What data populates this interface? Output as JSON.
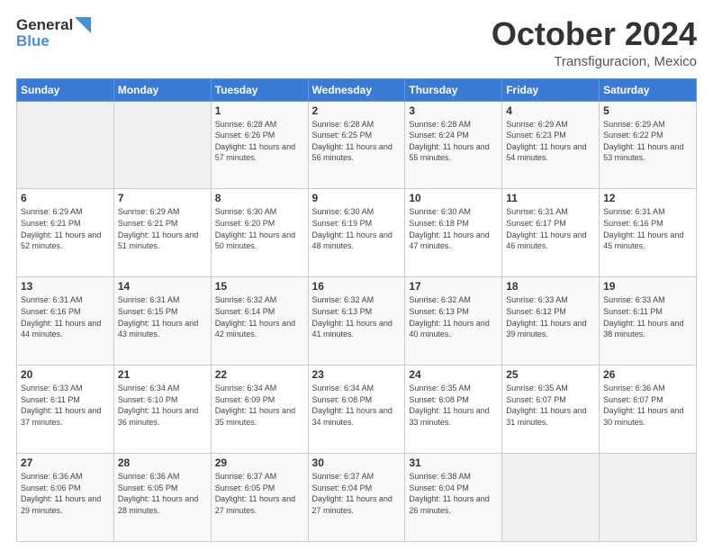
{
  "logo": {
    "line1": "General",
    "line2": "Blue"
  },
  "title": "October 2024",
  "location": "Transfiguracion, Mexico",
  "header_days": [
    "Sunday",
    "Monday",
    "Tuesday",
    "Wednesday",
    "Thursday",
    "Friday",
    "Saturday"
  ],
  "weeks": [
    [
      null,
      null,
      {
        "day": 1,
        "sunrise": "6:28 AM",
        "sunset": "6:26 PM",
        "daylight": "11 hours and 57 minutes."
      },
      {
        "day": 2,
        "sunrise": "6:28 AM",
        "sunset": "6:25 PM",
        "daylight": "11 hours and 56 minutes."
      },
      {
        "day": 3,
        "sunrise": "6:28 AM",
        "sunset": "6:24 PM",
        "daylight": "11 hours and 55 minutes."
      },
      {
        "day": 4,
        "sunrise": "6:29 AM",
        "sunset": "6:23 PM",
        "daylight": "11 hours and 54 minutes."
      },
      {
        "day": 5,
        "sunrise": "6:29 AM",
        "sunset": "6:22 PM",
        "daylight": "11 hours and 53 minutes."
      }
    ],
    [
      {
        "day": 6,
        "sunrise": "6:29 AM",
        "sunset": "6:21 PM",
        "daylight": "11 hours and 52 minutes."
      },
      {
        "day": 7,
        "sunrise": "6:29 AM",
        "sunset": "6:21 PM",
        "daylight": "11 hours and 51 minutes."
      },
      {
        "day": 8,
        "sunrise": "6:30 AM",
        "sunset": "6:20 PM",
        "daylight": "11 hours and 50 minutes."
      },
      {
        "day": 9,
        "sunrise": "6:30 AM",
        "sunset": "6:19 PM",
        "daylight": "11 hours and 48 minutes."
      },
      {
        "day": 10,
        "sunrise": "6:30 AM",
        "sunset": "6:18 PM",
        "daylight": "11 hours and 47 minutes."
      },
      {
        "day": 11,
        "sunrise": "6:31 AM",
        "sunset": "6:17 PM",
        "daylight": "11 hours and 46 minutes."
      },
      {
        "day": 12,
        "sunrise": "6:31 AM",
        "sunset": "6:16 PM",
        "daylight": "11 hours and 45 minutes."
      }
    ],
    [
      {
        "day": 13,
        "sunrise": "6:31 AM",
        "sunset": "6:16 PM",
        "daylight": "11 hours and 44 minutes."
      },
      {
        "day": 14,
        "sunrise": "6:31 AM",
        "sunset": "6:15 PM",
        "daylight": "11 hours and 43 minutes."
      },
      {
        "day": 15,
        "sunrise": "6:32 AM",
        "sunset": "6:14 PM",
        "daylight": "11 hours and 42 minutes."
      },
      {
        "day": 16,
        "sunrise": "6:32 AM",
        "sunset": "6:13 PM",
        "daylight": "11 hours and 41 minutes."
      },
      {
        "day": 17,
        "sunrise": "6:32 AM",
        "sunset": "6:13 PM",
        "daylight": "11 hours and 40 minutes."
      },
      {
        "day": 18,
        "sunrise": "6:33 AM",
        "sunset": "6:12 PM",
        "daylight": "11 hours and 39 minutes."
      },
      {
        "day": 19,
        "sunrise": "6:33 AM",
        "sunset": "6:11 PM",
        "daylight": "11 hours and 38 minutes."
      }
    ],
    [
      {
        "day": 20,
        "sunrise": "6:33 AM",
        "sunset": "6:11 PM",
        "daylight": "11 hours and 37 minutes."
      },
      {
        "day": 21,
        "sunrise": "6:34 AM",
        "sunset": "6:10 PM",
        "daylight": "11 hours and 36 minutes."
      },
      {
        "day": 22,
        "sunrise": "6:34 AM",
        "sunset": "6:09 PM",
        "daylight": "11 hours and 35 minutes."
      },
      {
        "day": 23,
        "sunrise": "6:34 AM",
        "sunset": "6:08 PM",
        "daylight": "11 hours and 34 minutes."
      },
      {
        "day": 24,
        "sunrise": "6:35 AM",
        "sunset": "6:08 PM",
        "daylight": "11 hours and 33 minutes."
      },
      {
        "day": 25,
        "sunrise": "6:35 AM",
        "sunset": "6:07 PM",
        "daylight": "11 hours and 31 minutes."
      },
      {
        "day": 26,
        "sunrise": "6:36 AM",
        "sunset": "6:07 PM",
        "daylight": "11 hours and 30 minutes."
      }
    ],
    [
      {
        "day": 27,
        "sunrise": "6:36 AM",
        "sunset": "6:06 PM",
        "daylight": "11 hours and 29 minutes."
      },
      {
        "day": 28,
        "sunrise": "6:36 AM",
        "sunset": "6:05 PM",
        "daylight": "11 hours and 28 minutes."
      },
      {
        "day": 29,
        "sunrise": "6:37 AM",
        "sunset": "6:05 PM",
        "daylight": "11 hours and 27 minutes."
      },
      {
        "day": 30,
        "sunrise": "6:37 AM",
        "sunset": "6:04 PM",
        "daylight": "11 hours and 27 minutes."
      },
      {
        "day": 31,
        "sunrise": "6:38 AM",
        "sunset": "6:04 PM",
        "daylight": "11 hours and 26 minutes."
      },
      null,
      null
    ]
  ],
  "labels": {
    "sunrise": "Sunrise:",
    "sunset": "Sunset:",
    "daylight": "Daylight:"
  }
}
